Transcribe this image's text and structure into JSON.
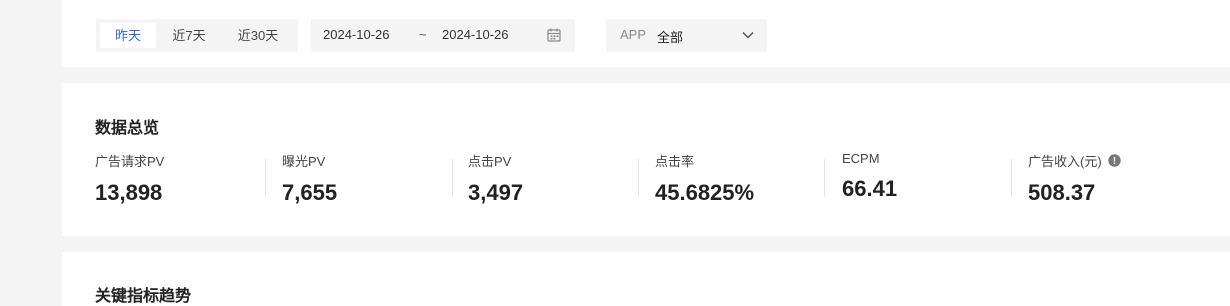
{
  "filters": {
    "date_tabs": [
      {
        "label": "昨天",
        "active": true
      },
      {
        "label": "近7天",
        "active": false
      },
      {
        "label": "近30天",
        "active": false
      }
    ],
    "date_range": {
      "start": "2024-10-26",
      "separator": "~",
      "end": "2024-10-26",
      "icon": "calendar-icon"
    },
    "app_select": {
      "label": "APP",
      "value": "全部",
      "icon": "chevron-down-icon"
    }
  },
  "overview": {
    "title": "数据总览",
    "metrics": [
      {
        "label": "广告请求PV",
        "value": "13,898"
      },
      {
        "label": "曝光PV",
        "value": "7,655"
      },
      {
        "label": "点击PV",
        "value": "3,497"
      },
      {
        "label": "点击率",
        "value": "45.6825%"
      },
      {
        "label": "ECPM",
        "value": "66.41"
      },
      {
        "label": "广告收入(元)",
        "value": "508.37",
        "icon": "info-icon"
      }
    ]
  },
  "trend": {
    "title": "关键指标趋势"
  },
  "colors": {
    "accent": "#2f6bdb",
    "page_bg": "#f4f4f5",
    "card_bg": "#ffffff"
  }
}
